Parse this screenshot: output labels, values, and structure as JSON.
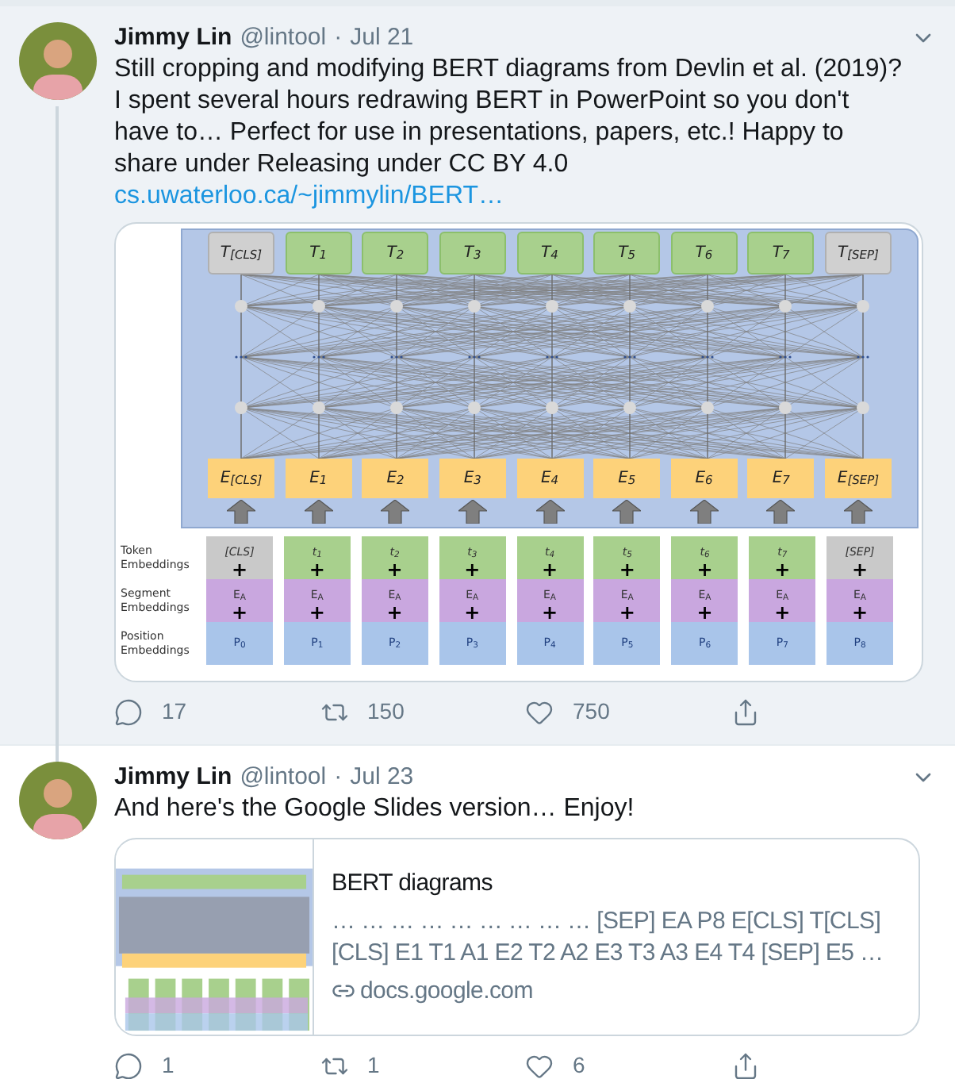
{
  "tweets": [
    {
      "name": "Jimmy Lin",
      "handle": "@lintool",
      "separator": "·",
      "date": "Jul 21",
      "selected": true,
      "thread_continues": true,
      "text": "Still cropping and modifying BERT diagrams from Devlin et al. (2019)? I spent several hours redrawing BERT in PowerPoint so you don't have to… Perfect for use in presentations, papers, etc.! Happy to share under Releasing under CC BY 4.0 ",
      "link": "cs.uwaterloo.ca/~jimmylin/BERT…",
      "media": {
        "kind": "diagram",
        "outputs": [
          {
            "label": "T$_{[CLS]}$",
            "kind": "special"
          },
          {
            "label": "T$_{1}$",
            "kind": "word"
          },
          {
            "label": "T$_{2}$",
            "kind": "word"
          },
          {
            "label": "T$_{3}$",
            "kind": "word"
          },
          {
            "label": "T$_{4}$",
            "kind": "word"
          },
          {
            "label": "T$_{5}$",
            "kind": "word"
          },
          {
            "label": "T$_{6}$",
            "kind": "word"
          },
          {
            "label": "T$_{7}$",
            "kind": "word"
          },
          {
            "label": "T$_{[SEP]}$",
            "kind": "special"
          }
        ],
        "embeddings": [
          "E$_{[CLS]}$",
          "E$_{1}$",
          "E$_{2}$",
          "E$_{3}$",
          "E$_{4}$",
          "E$_{5}$",
          "E$_{6}$",
          "E$_{7}$",
          "E$_{[SEP]}$"
        ],
        "row_labels": [
          "Token Embeddings",
          "Segment Embeddings",
          "Position Embeddings"
        ],
        "inputs": [
          {
            "token": "[CLS]",
            "kind": "special",
            "plus": [
              "+",
              "+"
            ],
            "segment": "E$_{A}$",
            "position": "P$_{0}$"
          },
          {
            "token": "t$_{1}$",
            "kind": "word",
            "plus": [
              "+",
              "+"
            ],
            "segment": "E$_{A}$",
            "position": "P$_{1}$"
          },
          {
            "token": "t$_{2}$",
            "kind": "word",
            "plus": [
              "+",
              "+"
            ],
            "segment": "E$_{A}$",
            "position": "P$_{2}$"
          },
          {
            "token": "t$_{3}$",
            "kind": "word",
            "plus": [
              "+",
              "+"
            ],
            "segment": "E$_{A}$",
            "position": "P$_{3}$"
          },
          {
            "token": "t$_{4}$",
            "kind": "word",
            "plus": [
              "+",
              "+"
            ],
            "segment": "E$_{A}$",
            "position": "P$_{4}$"
          },
          {
            "token": "t$_{5}$",
            "kind": "word",
            "plus": [
              "+",
              "+"
            ],
            "segment": "E$_{A}$",
            "position": "P$_{5}$"
          },
          {
            "token": "t$_{6}$",
            "kind": "word",
            "plus": [
              "+",
              "+"
            ],
            "segment": "E$_{A}$",
            "position": "P$_{6}$"
          },
          {
            "token": "t$_{7}$",
            "kind": "word",
            "plus": [
              "+",
              "+"
            ],
            "segment": "E$_{A}$",
            "position": "P$_{7}$"
          },
          {
            "token": "[SEP]",
            "kind": "special",
            "plus": [
              "+",
              "+"
            ],
            "segment": "E$_{A}$",
            "position": "P$_{8}$"
          }
        ]
      },
      "actions": [
        {
          "kind": "reply",
          "count": "17"
        },
        {
          "kind": "retweet",
          "count": "150"
        },
        {
          "kind": "like",
          "count": "750"
        },
        {
          "kind": "share"
        }
      ]
    },
    {
      "name": "Jimmy Lin",
      "handle": "@lintool",
      "separator": "·",
      "date": "Jul 23",
      "selected": false,
      "thread_continues": false,
      "text": "And here's the Google Slides version… Enjoy!",
      "card": {
        "title": "BERT diagrams",
        "description": "… … … … … … … … … [SEP] EA P8 E[CLS] T[CLS] [CLS] E1 T1 A1 E2 T2 A2 E3 T3 A3 E4 T4 [SEP] E5 …",
        "domain": "docs.google.com"
      },
      "actions": [
        {
          "kind": "reply",
          "count": "1"
        },
        {
          "kind": "retweet",
          "count": "1"
        },
        {
          "kind": "like",
          "count": "6"
        },
        {
          "kind": "share"
        }
      ]
    }
  ]
}
